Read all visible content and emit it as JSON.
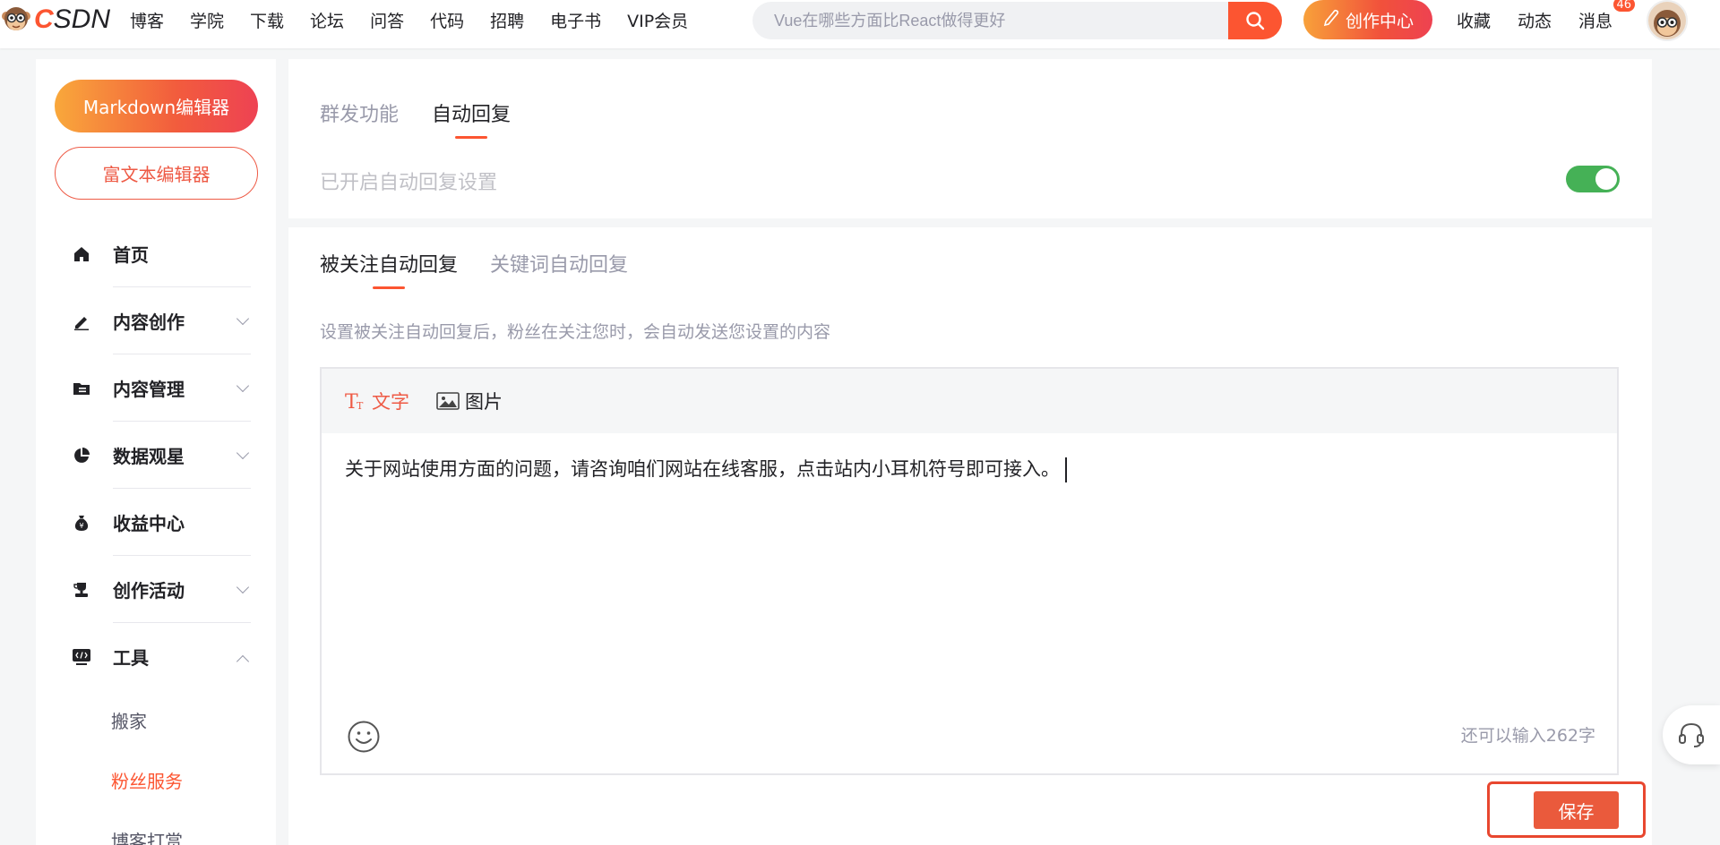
{
  "brand": {
    "logo_text": "CSDN",
    "accent": "#fc5531"
  },
  "nav": {
    "items": [
      "博客",
      "学院",
      "下载",
      "论坛",
      "问答",
      "代码",
      "招聘",
      "电子书",
      "VIP会员"
    ]
  },
  "search": {
    "placeholder": "Vue在哪些方面比React做得更好"
  },
  "header": {
    "create_label": "创作中心",
    "favorites_label": "收藏",
    "activity_label": "动态",
    "messages_label": "消息",
    "messages_badge": "46"
  },
  "sidebar": {
    "markdown_editor_label": "Markdown编辑器",
    "richtext_editor_label": "富文本编辑器",
    "items": [
      {
        "label": "首页",
        "icon": "home-icon"
      },
      {
        "label": "内容创作",
        "icon": "pen-icon"
      },
      {
        "label": "内容管理",
        "icon": "folder-icon"
      },
      {
        "label": "数据观星",
        "icon": "pie-chart-icon"
      },
      {
        "label": "收益中心",
        "icon": "money-bag-icon"
      },
      {
        "label": "创作活动",
        "icon": "trophy-icon"
      },
      {
        "label": "工具",
        "icon": "code-icon"
      }
    ],
    "tool_subitems": [
      {
        "label": "搬家"
      },
      {
        "label": "粉丝服务"
      },
      {
        "label": "博客打赏"
      }
    ]
  },
  "main": {
    "top_tabs": [
      "群发功能",
      "自动回复"
    ],
    "auto_reply_label": "已开启自动回复设置",
    "auto_reply_enabled": true,
    "sub_tabs": [
      "被关注自动回复",
      "关键词自动回复"
    ],
    "description": "设置被关注自动回复后，粉丝在关注您时，会自动发送您设置的内容",
    "editor": {
      "text_tool_label": "文字",
      "image_tool_label": "图片",
      "content": "关于网站使用方面的问题，请咨询咱们网站在线客服，点击站内小耳机符号即可接入。",
      "remaining": "还可以输入262字"
    },
    "save_label": "保存"
  }
}
